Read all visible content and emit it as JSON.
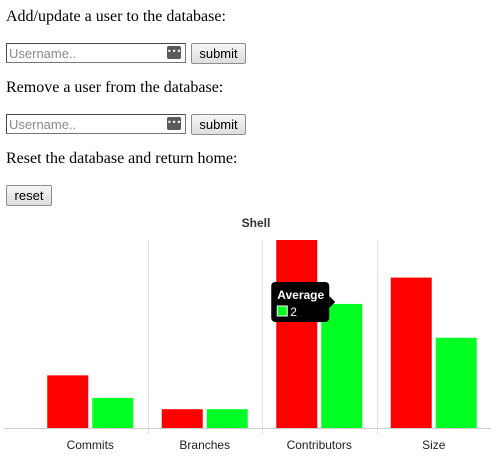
{
  "forms": {
    "add": {
      "heading": "Add/update a user to the database:",
      "placeholder": "Username..",
      "submit_label": "submit"
    },
    "remove": {
      "heading": "Remove a user from the database:",
      "placeholder": "Username..",
      "submit_label": "submit"
    },
    "reset": {
      "heading": "Reset the database and return home:",
      "button_label": "reset"
    }
  },
  "colors": {
    "series_1": "#ff0000",
    "series_2": "#00ff22",
    "tooltip_bg": "#000000"
  },
  "chart_data": {
    "type": "bar",
    "title": "Shell",
    "categories": [
      "Commits",
      "Branches",
      "Contributors",
      "Size"
    ],
    "series": [
      {
        "values": [
          14,
          5,
          50,
          40
        ],
        "color": "#ff0000"
      },
      {
        "name": "Average",
        "values": [
          8,
          5,
          33,
          24
        ],
        "color": "#00ff22"
      }
    ],
    "ylim": [
      0,
      50
    ],
    "grid": true,
    "tooltip": {
      "title": "Average",
      "value": "2",
      "category": "Contributors"
    }
  }
}
